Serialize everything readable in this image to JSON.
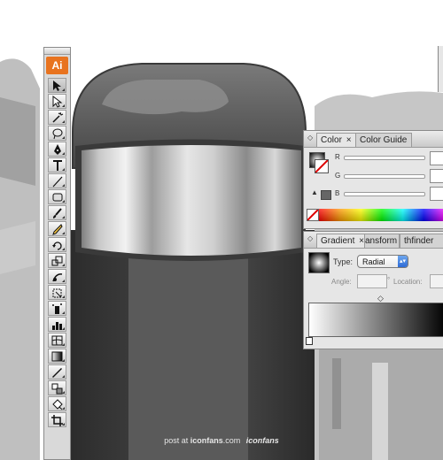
{
  "app": {
    "logo_text": "Ai"
  },
  "tools": [
    {
      "name": "selection-tool-icon"
    },
    {
      "name": "direct-selection-tool-icon"
    },
    {
      "name": "magic-wand-tool-icon"
    },
    {
      "name": "lasso-tool-icon"
    },
    {
      "name": "pen-tool-icon"
    },
    {
      "name": "type-tool-icon"
    },
    {
      "name": "line-tool-icon"
    },
    {
      "name": "rectangle-tool-icon"
    },
    {
      "name": "paintbrush-tool-icon"
    },
    {
      "name": "pencil-tool-icon"
    },
    {
      "name": "rotate-tool-icon"
    },
    {
      "name": "scale-tool-icon"
    },
    {
      "name": "warp-tool-icon"
    },
    {
      "name": "free-transform-tool-icon"
    },
    {
      "name": "symbol-sprayer-tool-icon"
    },
    {
      "name": "column-graph-tool-icon"
    },
    {
      "name": "mesh-tool-icon"
    },
    {
      "name": "gradient-tool-icon"
    },
    {
      "name": "eyedropper-tool-icon"
    },
    {
      "name": "blend-tool-icon"
    },
    {
      "name": "live-paint-bucket-tool-icon"
    },
    {
      "name": "crop-tool-icon"
    }
  ],
  "color_panel": {
    "tabs": [
      "Color",
      "Color Guide"
    ],
    "channels": [
      "R",
      "G",
      "B"
    ]
  },
  "gradient_panel": {
    "tabs": [
      "Gradient",
      "ansform",
      "thfinder"
    ],
    "type_label": "Type:",
    "type_value": "Radial",
    "angle_label": "Angle:",
    "location_label": "Location:"
  },
  "footer": {
    "prefix": "post at",
    "site": "iconfans",
    "suffix": ".com",
    "brand": "iconfans"
  },
  "colors": {
    "illustrator_orange": "#e8731f",
    "tab_bg": "#d3d3d3",
    "panel_bg": "#e6e6e6"
  }
}
